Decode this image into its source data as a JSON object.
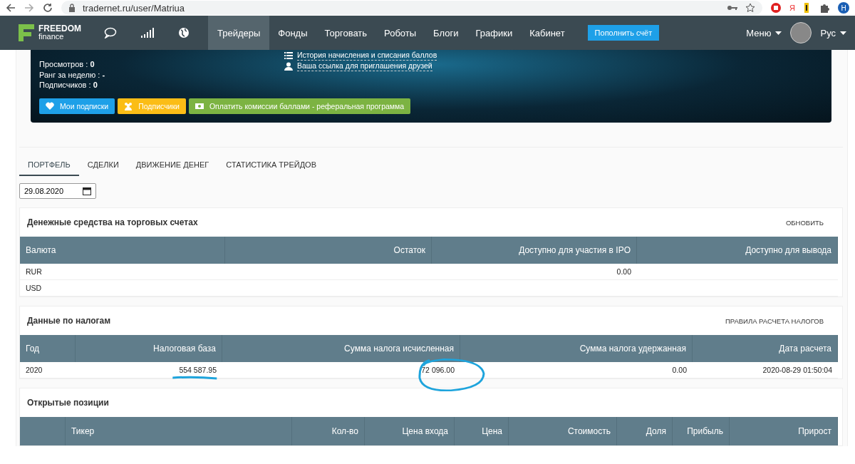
{
  "browser": {
    "url": "tradernet.ru/user/Matriua",
    "profile_initial": "Н",
    "ext_label": "Я"
  },
  "nav": {
    "logo_top": "FREEDOM",
    "logo_bottom": "finance",
    "items": [
      {
        "label": "Трейдеры",
        "selected": true
      },
      {
        "label": "Фонды",
        "selected": false
      },
      {
        "label": "Торговать",
        "selected": false
      },
      {
        "label": "Роботы",
        "selected": false
      },
      {
        "label": "Блоги",
        "selected": false
      },
      {
        "label": "Графики",
        "selected": false
      },
      {
        "label": "Кабинет",
        "selected": false
      }
    ],
    "deposit_button": "Пополнить счёт",
    "menu": "Меню",
    "language": "Рус"
  },
  "profile": {
    "stats": [
      {
        "label": "Просмотров : ",
        "value": "0"
      },
      {
        "label": "Ранг за неделю : ",
        "value": "-"
      },
      {
        "label": "Подписчиков : ",
        "value": "0"
      }
    ],
    "links": [
      {
        "kind": "list",
        "text": "История начисления и списания баллов"
      },
      {
        "kind": "user",
        "text": "Ваша ссылка для приглашения друзей"
      }
    ],
    "buttons": [
      {
        "kind": "heart",
        "label": "Мои подписки",
        "color": "#1ea0e8"
      },
      {
        "kind": "group",
        "label": "Подписчики",
        "color": "#fbbd16"
      },
      {
        "kind": "money",
        "label": "Оплатить комиссии баллами - реферальная программа",
        "color": "#7cb342"
      }
    ]
  },
  "tabs": [
    {
      "label": "ПОРТФЕЛЬ",
      "selected": true
    },
    {
      "label": "СДЕЛКИ",
      "selected": false
    },
    {
      "label": "ДВИЖЕНИЕ ДЕНЕГ",
      "selected": false
    },
    {
      "label": "СТАТИСТИКА ТРЕЙДОВ",
      "selected": false
    }
  ],
  "date": {
    "value": "29.08.2020"
  },
  "cash": {
    "title": "Денежные средства на торговых счетах",
    "action": "ОБНОВИТЬ",
    "columns": [
      "Валюта",
      "Остаток",
      "Доступно для участия в IPO",
      "Доступно для вывода"
    ],
    "rows": [
      [
        "RUR",
        null,
        "0.00",
        null
      ],
      [
        "USD",
        null,
        null,
        null
      ]
    ]
  },
  "taxes": {
    "title": "Данные по налогам",
    "action": "ПРАВИЛА РАСЧЕТА НАЛОГОВ",
    "columns": [
      "Год",
      "Налоговая база",
      "Сумма налога исчисленная",
      "Сумма налога удержанная",
      "Дата расчета"
    ],
    "rows": [
      {
        "cells": [
          "2020",
          {
            "text": "554 587.95",
            "underlined": true,
            "circled": false
          },
          {
            "text": "72 096.00",
            "underlined": false,
            "circled": true
          },
          "0.00",
          "2020-08-29 01:50:04"
        ]
      }
    ]
  },
  "positions": {
    "title": "Открытые позиции",
    "columns": [
      "",
      "Тикер",
      "Кол-во",
      "Цена входа",
      "Цена",
      "Стоимость",
      "Доля",
      "Прибыль",
      "Прирост"
    ]
  }
}
